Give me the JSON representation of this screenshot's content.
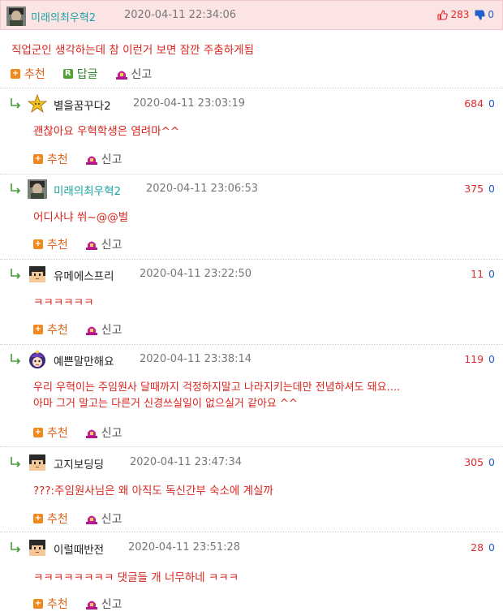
{
  "main_post": {
    "author": "미래의최우혁2",
    "date": "2020-04-11 22:34:06",
    "upvotes": "283",
    "downvotes": "0",
    "body": "직업군인 생각하는데 참 이런거 보면 잠깐 주춤하게됨",
    "actions": {
      "recommend": "추천",
      "reply": "답글",
      "report": "신고"
    }
  },
  "replies": [
    {
      "author": "별을꿈꾸다2",
      "date": "2020-04-11 23:03:19",
      "up": "684",
      "down": "0",
      "body": [
        "괜찮아요 우혁학생은 염려마^^"
      ],
      "avatar_icon": "star-icon"
    },
    {
      "author": "미래의최우혁2",
      "date": "2020-04-11 23:06:53",
      "up": "375",
      "down": "0",
      "body": [
        "어디사냐 쒸~@@벌"
      ],
      "avatar_icon": "photo-avatar"
    },
    {
      "author": "유메에스프리",
      "date": "2020-04-11 23:22:50",
      "up": "11",
      "down": "0",
      "body": [
        "ㅋㅋㅋㅋㅋㅋ"
      ],
      "avatar_icon": "pixel-face-icon"
    },
    {
      "author": "예쁜말만해요",
      "date": "2020-04-11 23:38:14",
      "up": "119",
      "down": "0",
      "body": [
        "우리 우혁이는 주임원사 달때까지 걱정하지말고 나라지키는데만 전념하셔도 돼요....",
        "아마 그거 말고는 다른거 신경쓰실일이 없으실거 같아요 ^^"
      ],
      "avatar_icon": "witch-avatar-icon"
    },
    {
      "author": "고지보딩딩",
      "date": "2020-04-11 23:47:34",
      "up": "305",
      "down": "0",
      "body": [
        "???:주임원사님은 왜 아직도 독신간부 숙소에 계실까"
      ],
      "avatar_icon": "pixel-face-icon"
    },
    {
      "author": "이럴때반전",
      "date": "2020-04-11 23:51:28",
      "up": "28",
      "down": "0",
      "body": [
        "ㅋㅋㅋㅋㅋㅋㅋㅋ 댓글들 개 너무하네 ㅋㅋㅋ"
      ],
      "avatar_icon": "pixel-face-icon"
    }
  ],
  "reply_actions": {
    "recommend": "추천",
    "report": "신고"
  },
  "colors": {
    "header_bg": "#fde4e4",
    "body_text": "#d9251d",
    "upvote": "#e1282d",
    "downvote": "#2260c9",
    "author_teal": "#1aa3a3"
  }
}
